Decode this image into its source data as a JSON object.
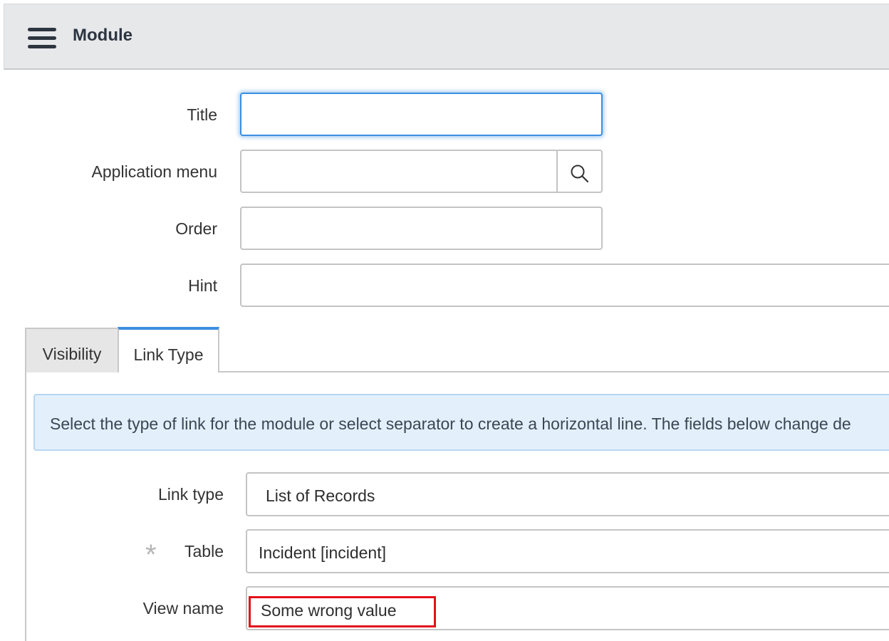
{
  "header": {
    "title": "Module"
  },
  "form": {
    "title_label": "Title",
    "title_value": "",
    "app_menu_label": "Application menu",
    "app_menu_value": "",
    "order_label": "Order",
    "order_value": "",
    "hint_label": "Hint",
    "hint_value": ""
  },
  "tabs": [
    {
      "label": "Visibility",
      "active": false
    },
    {
      "label": "Link Type",
      "active": true
    }
  ],
  "link_type_section": {
    "info_text": "Select the type of link for the module or select separator to create a horizontal line. The fields below change de",
    "link_type_label": "Link type",
    "link_type_value": "List of Records",
    "table_label": "Table",
    "table_value": "Incident [incident]",
    "view_name_label": "View name",
    "view_name_value": "Some wrong value"
  },
  "colors": {
    "focus": "#3b8fe0",
    "info_bg": "#e3f0fc",
    "highlight": "#e3101a"
  }
}
